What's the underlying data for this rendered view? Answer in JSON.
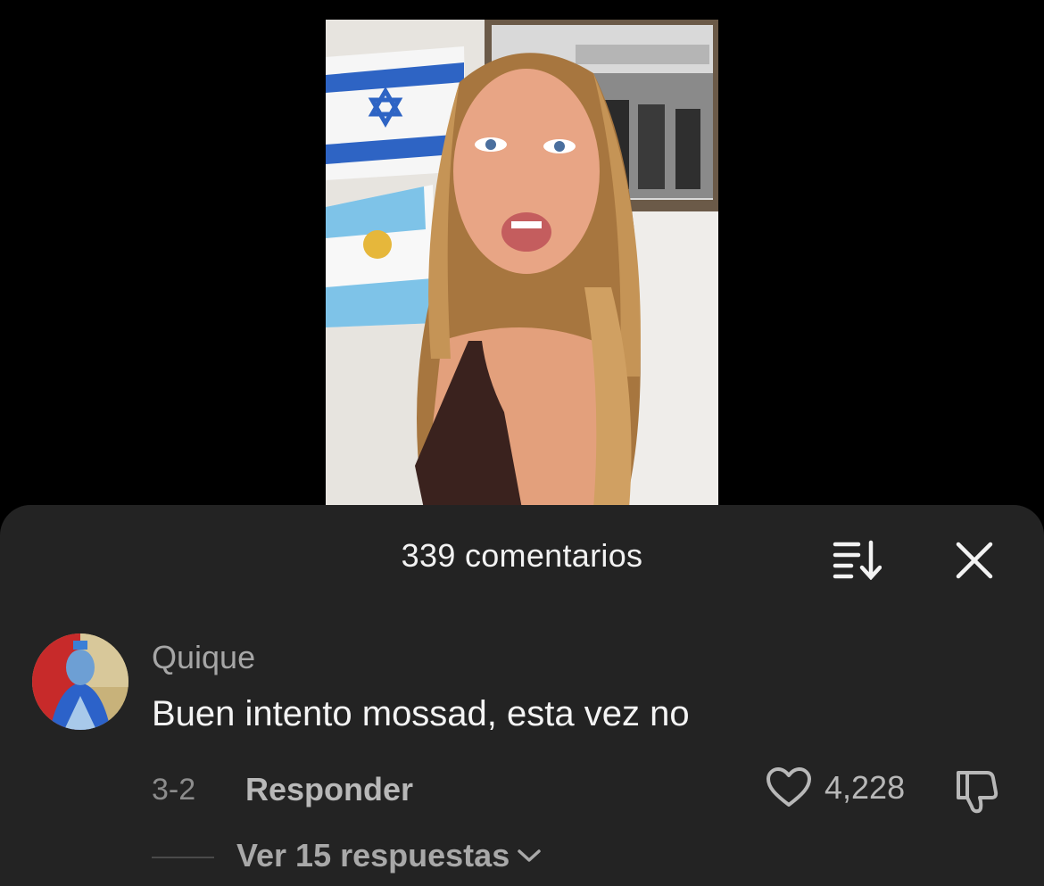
{
  "sheet": {
    "title": "339 comentarios",
    "sort_icon": "sort-icon",
    "close_icon": "close-icon"
  },
  "comment": {
    "username": "Quique",
    "text": "Buen intento mossad, esta vez no",
    "date": "3-2",
    "reply_label": "Responder",
    "like_count": "4,228",
    "like_icon": "heart-icon",
    "dislike_icon": "thumbs-down-icon",
    "view_replies_label": "Ver 15 respuestas",
    "view_replies_icon": "chevron-down-icon"
  },
  "colors": {
    "background": "#000000",
    "sheet": "#232323",
    "primary_text": "#f4f4f4",
    "secondary_text": "#a6a6a6"
  }
}
